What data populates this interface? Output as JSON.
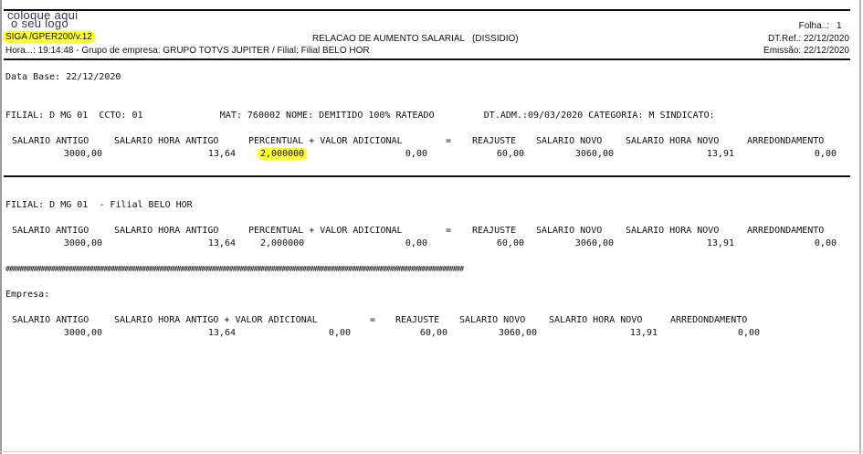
{
  "header": {
    "logo_line1": "coloque aqui",
    "logo_line2": "o seu logo",
    "program": "SIGA /GPER200/v.12",
    "title": "RELACAO DE AUMENTO SALARIAL   (DISSIDIO)",
    "folha_label": "Folha..:",
    "folha_value": "1",
    "hora_line": "Hora...: 19:14:48 - Grupo de empresa: GRUPO TOTVS JUPITER / Filial: Filial BELO HOR",
    "dtref": "DT.Ref.: 22/12/2020",
    "emissao": "Emissão: 22/12/2020",
    "highlight_color": "#ffff33"
  },
  "data_base": "Data Base: 22/12/2020",
  "employee_line": "FILIAL: D MG 01  CCTO: 01              MAT: 760002 NOME: DEMITIDO 100% RATEADO         DT.ADM.:09/03/2020 CATEGORIA: M SINDICATO:",
  "sec1": {
    "headers": [
      "SALARIO ANTIGO",
      "SALARIO HORA ANTIGO",
      "PERCENTUAL + VALOR ADICIONAL",
      "=",
      "REAJUSTE",
      "SALARIO NOVO",
      "SALARIO HORA NOVO",
      "ARREDONDAMENTO"
    ],
    "values": [
      "3000,00",
      "13,64",
      "2,000000",
      "0,00",
      "60,00",
      "3060,00",
      "13,91",
      "0,00"
    ]
  },
  "filial_line": "FILIAL: D MG 01  - Filial BELO HOR",
  "sec2": {
    "headers": [
      "SALARIO ANTIGO",
      "SALARIO HORA ANTIGO",
      "PERCENTUAL + VALOR ADICIONAL",
      "=",
      "REAJUSTE",
      "SALARIO NOVO",
      "SALARIO HORA NOVO",
      "ARREDONDAMENTO"
    ],
    "values": [
      "3000,00",
      "13,64",
      "2,000000",
      "0,00",
      "60,00",
      "3060,00",
      "13,91",
      "0,00"
    ]
  },
  "hash_line": "###################################################################################################################################",
  "empresa_label": "Empresa:",
  "sec3": {
    "headers": [
      "SALARIO ANTIGO",
      "SALARIO HORA ANTIGO + VALOR ADICIONAL",
      "=",
      "REAJUSTE",
      "SALARIO NOVO",
      "SALARIO HORA NOVO",
      "ARREDONDAMENTO"
    ],
    "values": [
      "3000,00",
      "13,64",
      "0,00",
      "60,00",
      "3060,00",
      "13,91",
      "0,00"
    ]
  }
}
